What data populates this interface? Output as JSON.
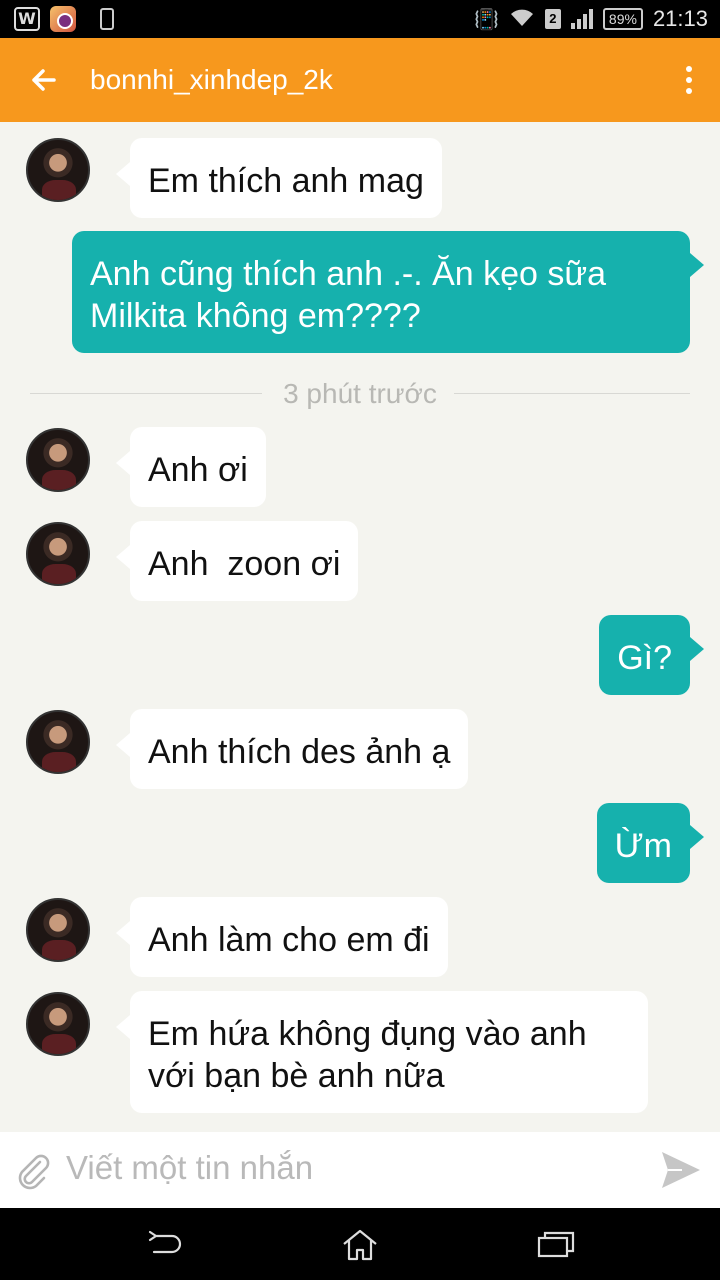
{
  "status_bar": {
    "app_icon_letter": "W",
    "battery": "89%",
    "sim": "2",
    "time": "21:13"
  },
  "header": {
    "title": "bonnhi_xinhdep_2k"
  },
  "messages": [
    {
      "from": "them",
      "text": "Em thích anh mag"
    },
    {
      "from": "me",
      "text": "Anh cũng thích anh .-. Ăn kẹo sữa Milkita không em????"
    },
    {
      "from": "them",
      "text": "Anh ơi"
    },
    {
      "from": "them",
      "text": "Anh  zoon ơi"
    },
    {
      "from": "me",
      "text": "Gì?"
    },
    {
      "from": "them",
      "text": "Anh thích des ảnh ạ"
    },
    {
      "from": "me",
      "text": "Ừm"
    },
    {
      "from": "them",
      "text": "Anh làm cho em đi"
    },
    {
      "from": "them",
      "text": "Em hứa không đụng vào anh với bạn bè anh nữa"
    }
  ],
  "divider": {
    "text": "3 phút trước"
  },
  "composer": {
    "placeholder": "Viết một tin nhắn"
  },
  "colors": {
    "accent_orange": "#f7981d",
    "outgoing_bubble": "#16b1ad",
    "incoming_bubble": "#ffffff",
    "background": "#f4f4ef"
  },
  "icons": {
    "back": "arrow-left-icon",
    "more": "more-vertical-icon",
    "attach": "paperclip-icon",
    "send": "send-icon"
  }
}
